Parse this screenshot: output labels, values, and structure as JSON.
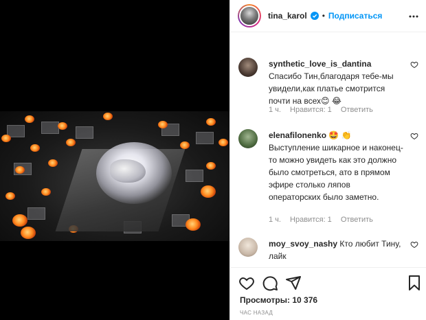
{
  "post": {
    "author": "tina_karol",
    "follow_label": "Подписаться",
    "separator": "•"
  },
  "comments": [
    {
      "user": "synthetic_love_is_dantina",
      "text": "Спасибо Тин,благодаря тебе-мы увидели,как платье смотрится почти на всех😊 😂",
      "time": "1 ч.",
      "likes": "Нравится: 1",
      "reply": "Ответить"
    },
    {
      "user": "elenafilonenko",
      "text": "🤩 👏 Выступление шикарное и наконец-то можно увидеть как это должно было смотреться, ато в прямом эфире столько ляпов операторских было заметно.",
      "time": "1 ч.",
      "likes": "Нравится: 1",
      "reply": "Ответить"
    },
    {
      "user": "moy_svoy_nashy",
      "text": "Кто любит Тину, лайк"
    }
  ],
  "stats": {
    "views": "Просмотры: 10 376",
    "time_ago": "час назад"
  },
  "icons": {
    "like": "heart-icon",
    "comment": "comment-icon",
    "share": "paper-plane-icon",
    "save": "bookmark-icon",
    "more": "more-dots-icon",
    "verified": "verified-badge-icon"
  },
  "colors": {
    "accent": "#0095f6",
    "muted": "#8e8e8e",
    "text": "#262626"
  }
}
